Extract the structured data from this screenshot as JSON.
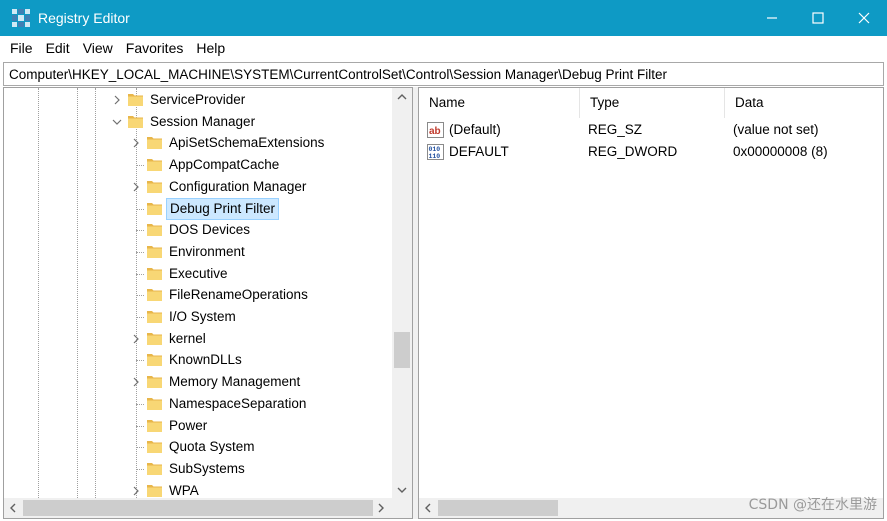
{
  "window": {
    "title": "Registry Editor"
  },
  "menu": [
    {
      "label": "File"
    },
    {
      "label": "Edit"
    },
    {
      "label": "View"
    },
    {
      "label": "Favorites"
    },
    {
      "label": "Help"
    }
  ],
  "address": {
    "path": "Computer\\HKEY_LOCAL_MACHINE\\SYSTEM\\CurrentControlSet\\Control\\Session Manager\\Debug Print Filter"
  },
  "tree": {
    "items": [
      {
        "label": "ServiceProvider",
        "expander": "collapsed"
      },
      {
        "label": "Session Manager",
        "expander": "expanded"
      },
      {
        "label": "ApiSetSchemaExtensions",
        "expander": "collapsed"
      },
      {
        "label": "AppCompatCache",
        "expander": "none"
      },
      {
        "label": "Configuration Manager",
        "expander": "collapsed"
      },
      {
        "label": "Debug Print Filter",
        "expander": "none",
        "selected": true
      },
      {
        "label": "DOS Devices",
        "expander": "none"
      },
      {
        "label": "Environment",
        "expander": "none"
      },
      {
        "label": "Executive",
        "expander": "none"
      },
      {
        "label": "FileRenameOperations",
        "expander": "none"
      },
      {
        "label": "I/O System",
        "expander": "none"
      },
      {
        "label": "kernel",
        "expander": "collapsed"
      },
      {
        "label": "KnownDLLs",
        "expander": "none"
      },
      {
        "label": "Memory Management",
        "expander": "collapsed"
      },
      {
        "label": "NamespaceSeparation",
        "expander": "none"
      },
      {
        "label": "Power",
        "expander": "none"
      },
      {
        "label": "Quota System",
        "expander": "none"
      },
      {
        "label": "SubSystems",
        "expander": "none"
      },
      {
        "label": "WPA",
        "expander": "collapsed"
      }
    ]
  },
  "values": {
    "columns": {
      "name": "Name",
      "type": "Type",
      "data": "Data"
    },
    "rows": [
      {
        "name": "(Default)",
        "type": "REG_SZ",
        "data": "(value not set)",
        "icon": "string-value-icon"
      },
      {
        "name": "DEFAULT",
        "type": "REG_DWORD",
        "data": "0x00000008 (8)",
        "icon": "binary-value-icon"
      }
    ]
  },
  "watermark": "CSDN @还在水里游",
  "colors": {
    "titlebar": "#0e9ac5",
    "selection": "#cce8ff",
    "folder": "#f8d775"
  }
}
